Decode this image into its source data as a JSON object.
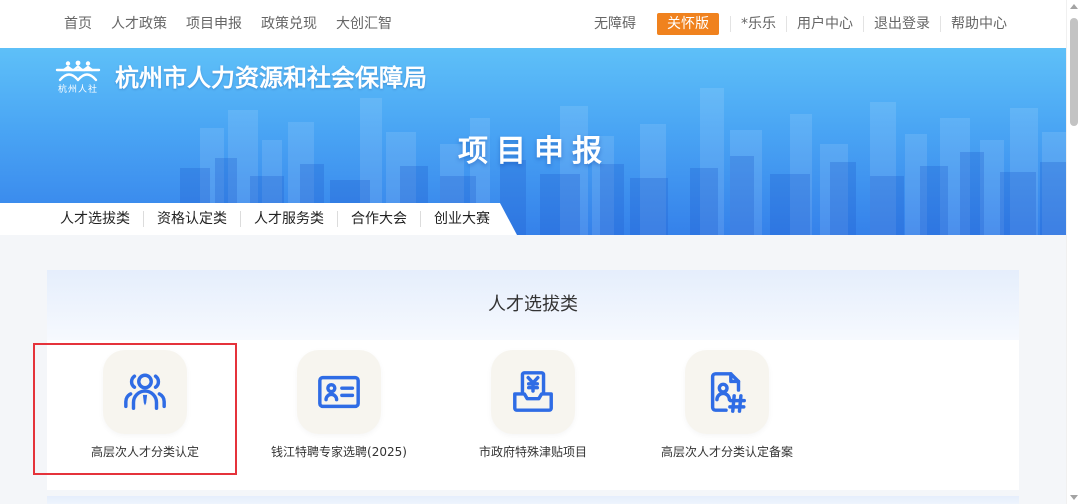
{
  "top_nav": {
    "links": [
      "首页",
      "人才政策",
      "项目申报",
      "政策兑现",
      "大创汇智"
    ],
    "accessibility": "无障碍",
    "care_mode": "关怀版",
    "user_name": "*乐乐",
    "user_center": "用户中心",
    "logout": "退出登录",
    "help_center": "帮助中心"
  },
  "banner": {
    "logo_caption": "杭州人社",
    "org_name": "杭州市人力资源和社会保障局",
    "page_title": "项目申报"
  },
  "category_tabs": [
    "人才选拔类",
    "资格认定类",
    "人才服务类",
    "合作大会",
    "创业大赛"
  ],
  "section": {
    "title": "人才选拔类",
    "items": [
      {
        "label": "高层次人才分类认定",
        "icon": "user-group-icon",
        "highlighted": true
      },
      {
        "label": "钱江特聘专家选聘(2025)",
        "icon": "id-card-icon",
        "highlighted": false
      },
      {
        "label": "市政府特殊津贴项目",
        "icon": "yen-tray-icon",
        "highlighted": false
      },
      {
        "label": "高层次人才分类认定备案",
        "icon": "document-user-hash-icon",
        "highlighted": false
      }
    ]
  },
  "icons": {
    "logo": "hangzhou-hrss-logo-icon",
    "scroll_up": "scroll-up-arrow-icon",
    "scroll_down": "scroll-down-arrow-icon"
  },
  "colors": {
    "care_button": "#f0821e",
    "icon_blue": "#2f6ce5",
    "highlight_border": "#e5333b",
    "banner_top": "#5ec0f8",
    "banner_bottom": "#3581ea",
    "icon_tile": "#f7f5ef"
  }
}
